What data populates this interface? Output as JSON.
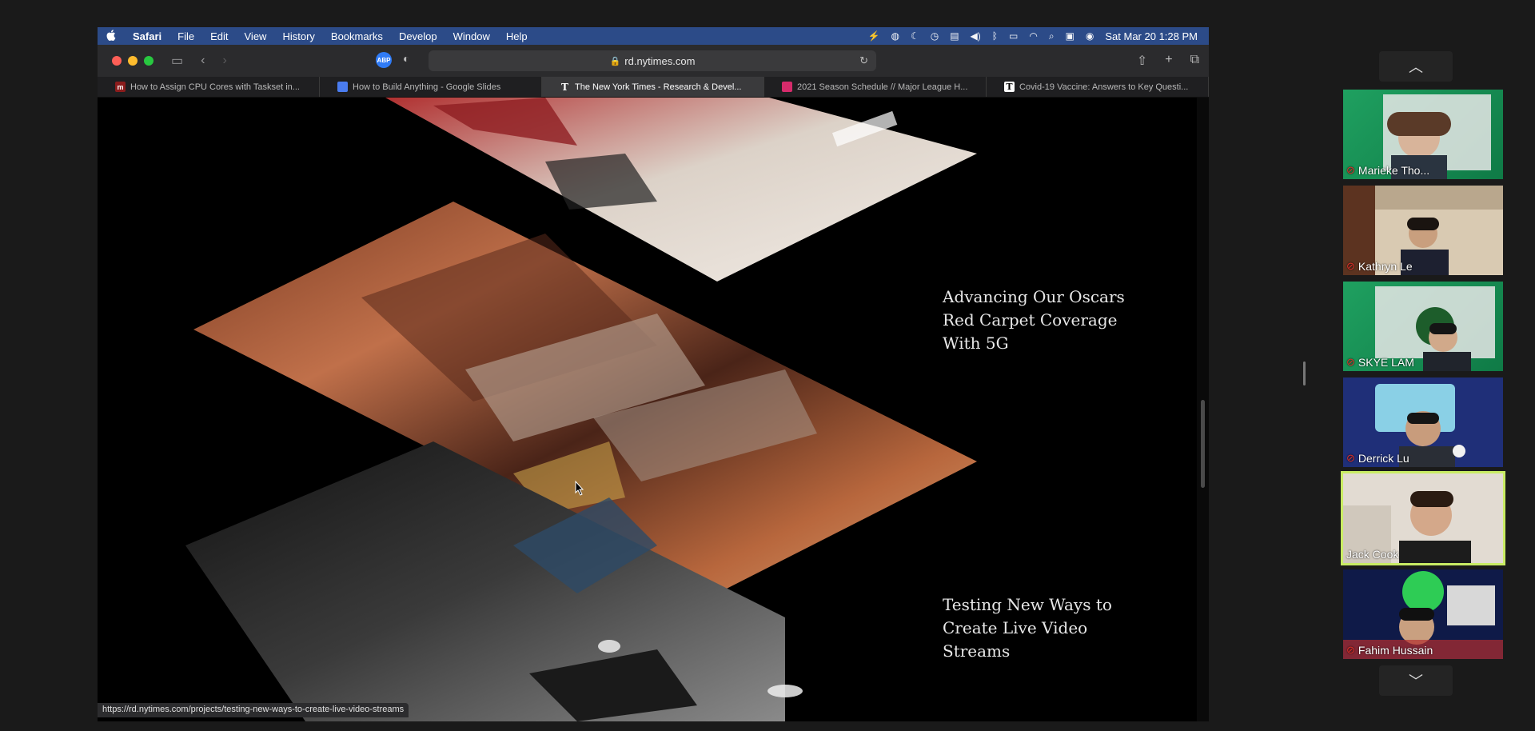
{
  "menubar": {
    "apple": "",
    "items": [
      "Safari",
      "File",
      "Edit",
      "View",
      "History",
      "Bookmarks",
      "Develop",
      "Window",
      "Help"
    ],
    "datetime": "Sat Mar 20  1:28 PM"
  },
  "browser": {
    "url": "rd.nytimes.com",
    "tabs": [
      {
        "title": "How to Assign CPU Cores with Taskset in...",
        "favicon": "m"
      },
      {
        "title": "How to Build Anything - Google Slides",
        "favicon": "slides"
      },
      {
        "title": "The New York Times - Research & Devel...",
        "favicon": "T"
      },
      {
        "title": "2021 Season Schedule // Major League H...",
        "favicon": "mlh"
      },
      {
        "title": "Covid-19 Vaccine: Answers to Key Questi...",
        "favicon": "T"
      }
    ],
    "active_tab": 2,
    "status_url": "https://rd.nytimes.com/projects/testing-new-ways-to-create-live-video-streams"
  },
  "page": {
    "headline_1": "Advancing Our Oscars Red Carpet Coverage With 5G",
    "headline_2": "Testing New Ways to Create Live Video Streams"
  },
  "participants": [
    {
      "name": "Marieke Tho...",
      "muted": true
    },
    {
      "name": "Kathryn Le",
      "muted": true
    },
    {
      "name": "SKYE LAM",
      "muted": true
    },
    {
      "name": "Derrick Lu",
      "muted": true
    },
    {
      "name": "Jack Cook",
      "muted": false,
      "speaking": true
    },
    {
      "name": "Fahim Hussain",
      "muted": true
    }
  ],
  "colors": {
    "menubar": "#2c4b88",
    "speaker_highlight": "#c9ec64",
    "mute": "#e0302a"
  }
}
